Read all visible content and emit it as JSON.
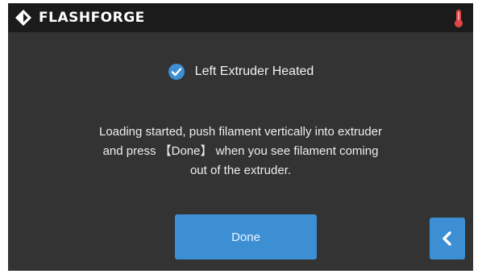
{
  "header": {
    "brand_name": "FLASHFORGE",
    "logo_icon": "flashforge-logo-icon",
    "temperature_icon": "thermometer-icon"
  },
  "status": {
    "label": "Left Extruder Heated",
    "icon": "checkmark-circle-icon",
    "checked": true
  },
  "message": {
    "line1": "Loading started, push filament vertically into extruder",
    "line2": "and press 【Done】 when you see filament coming",
    "line3": "out of the extruder."
  },
  "actions": {
    "done_label": "Done",
    "back_icon": "chevron-left-icon"
  },
  "colors": {
    "background": "#333333",
    "topbar": "#1b1b1b",
    "accent_blue": "#3d8fd4",
    "temperature_red": "#e04545"
  }
}
